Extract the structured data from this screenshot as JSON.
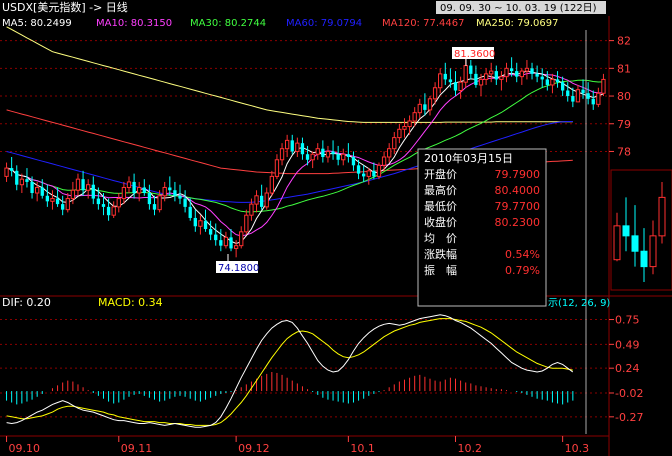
{
  "header": {
    "symbol_title": "USDX[美元指数] -> 日线",
    "date_range": "09. 09. 30 ~ 10. 03. 19 (122日)"
  },
  "ma_legend": [
    {
      "label": "MA5: 80.2499",
      "color": "#ffffff"
    },
    {
      "label": "MA10: 80.3150",
      "color": "#ff40ff"
    },
    {
      "label": "MA30: 80.2744",
      "color": "#40ff40"
    },
    {
      "label": "MA60: 79.0794",
      "color": "#2020ff"
    },
    {
      "label": "MA120: 77.4467",
      "color": "#ff4040"
    },
    {
      "label": "MA250: 79.0697",
      "color": "#ffff80"
    }
  ],
  "annotations": {
    "high_marker": "81.3600",
    "low_marker": "74.1800"
  },
  "info_box": {
    "date": "2010年03月15日",
    "rows": [
      {
        "label": "开盘价",
        "value": "79.7900"
      },
      {
        "label": "最高价",
        "value": "80.4000"
      },
      {
        "label": "最低价",
        "value": "79.7700"
      },
      {
        "label": "收盘价",
        "value": "80.2300"
      },
      {
        "label": "均　价",
        "value": ""
      },
      {
        "label": "涨跌幅",
        "value": "0.54%"
      },
      {
        "label": "振　幅",
        "value": "0.79%"
      }
    ]
  },
  "macd_panel": {
    "dif_label": "DIF: 0.20",
    "macd_label": "MACD: 0.34",
    "params_label": "示(12, 26, 9)"
  },
  "price_axis_labels": [
    "82",
    "81",
    "80",
    "79",
    "78"
  ],
  "macd_axis_labels": [
    "0.75",
    "0.49",
    "0.24",
    "-0.02",
    "-0.27"
  ],
  "date_axis_labels": [
    "09.10",
    "09.11",
    "09.12",
    "10.1",
    "10.2",
    "10.3"
  ],
  "colors": {
    "background": "#000000",
    "axis_text": "#ff4040",
    "grid": "#8b0000",
    "up_candle": "#ff3030",
    "down_candle": "#00ffff",
    "dif_line": "#ffffff",
    "dea_line": "#ffff00",
    "marker_bg": "#ffffff"
  },
  "chart_data": {
    "type": "candlestick",
    "price_ylim": [
      73,
      82.6
    ],
    "macd_ylim": [
      -0.45,
      0.85
    ],
    "candles": [
      [
        77.1,
        77.6,
        76.9,
        77.4
      ],
      [
        77.4,
        77.8,
        77.1,
        77.3
      ],
      [
        77.3,
        77.5,
        76.6,
        76.8
      ],
      [
        76.8,
        77.2,
        76.5,
        77.0
      ],
      [
        77.0,
        77.4,
        76.7,
        76.9
      ],
      [
        76.9,
        77.1,
        76.3,
        76.5
      ],
      [
        76.5,
        76.9,
        76.2,
        76.7
      ],
      [
        76.7,
        77.0,
        76.3,
        76.4
      ],
      [
        76.4,
        76.8,
        76.0,
        76.2
      ],
      [
        76.2,
        76.6,
        75.9,
        76.3
      ],
      [
        76.3,
        76.7,
        76.0,
        76.1
      ],
      [
        76.1,
        76.4,
        75.7,
        75.9
      ],
      [
        75.9,
        76.5,
        75.8,
        76.3
      ],
      [
        76.3,
        76.9,
        76.1,
        76.6
      ],
      [
        76.6,
        77.2,
        76.4,
        77.0
      ],
      [
        77.0,
        77.3,
        76.4,
        76.6
      ],
      [
        76.6,
        77.0,
        76.3,
        76.8
      ],
      [
        76.8,
        77.1,
        76.1,
        76.3
      ],
      [
        76.3,
        76.7,
        75.9,
        76.1
      ],
      [
        76.1,
        76.5,
        75.7,
        76.0
      ],
      [
        76.0,
        76.3,
        75.5,
        75.7
      ],
      [
        75.7,
        76.2,
        75.6,
        76.0
      ],
      [
        76.0,
        76.5,
        75.8,
        76.3
      ],
      [
        76.3,
        76.9,
        76.1,
        76.7
      ],
      [
        76.7,
        77.1,
        76.5,
        76.9
      ],
      [
        76.9,
        77.2,
        76.3,
        76.5
      ],
      [
        76.5,
        76.9,
        76.2,
        76.7
      ],
      [
        76.7,
        77.0,
        76.4,
        76.5
      ],
      [
        76.5,
        76.8,
        75.9,
        76.1
      ],
      [
        76.1,
        76.4,
        75.7,
        75.9
      ],
      [
        75.9,
        76.6,
        75.8,
        76.4
      ],
      [
        76.4,
        76.9,
        76.2,
        76.7
      ],
      [
        76.7,
        77.1,
        76.4,
        76.6
      ],
      [
        76.6,
        76.9,
        76.2,
        76.4
      ],
      [
        76.4,
        76.8,
        76.1,
        76.3
      ],
      [
        76.3,
        76.6,
        75.8,
        76.0
      ],
      [
        76.0,
        76.3,
        75.5,
        75.6
      ],
      [
        75.6,
        75.9,
        75.1,
        75.3
      ],
      [
        75.3,
        75.7,
        75.0,
        75.5
      ],
      [
        75.5,
        75.9,
        75.1,
        75.2
      ],
      [
        75.2,
        75.5,
        74.8,
        75.0
      ],
      [
        75.0,
        75.4,
        74.6,
        74.8
      ],
      [
        74.8,
        75.2,
        74.4,
        74.6
      ],
      [
        74.6,
        75.1,
        74.5,
        74.9
      ],
      [
        74.9,
        75.2,
        74.4,
        74.5
      ],
      [
        74.5,
        74.8,
        74.18,
        74.6
      ],
      [
        74.6,
        75.3,
        74.5,
        75.1
      ],
      [
        75.1,
        75.9,
        75.0,
        75.7
      ],
      [
        75.7,
        76.3,
        75.5,
        76.1
      ],
      [
        76.1,
        76.6,
        75.8,
        76.4
      ],
      [
        76.4,
        76.8,
        75.9,
        76.0
      ],
      [
        76.0,
        76.7,
        75.9,
        76.5
      ],
      [
        76.5,
        77.3,
        76.4,
        77.1
      ],
      [
        77.1,
        77.9,
        77.0,
        77.7
      ],
      [
        77.7,
        78.3,
        77.5,
        78.1
      ],
      [
        78.1,
        78.6,
        77.8,
        78.4
      ],
      [
        78.4,
        78.6,
        77.9,
        78.0
      ],
      [
        78.0,
        78.5,
        77.8,
        78.3
      ],
      [
        78.3,
        78.5,
        77.7,
        77.9
      ],
      [
        77.9,
        78.2,
        77.5,
        77.7
      ],
      [
        77.7,
        78.0,
        77.4,
        77.9
      ],
      [
        77.9,
        78.3,
        77.7,
        78.1
      ],
      [
        78.1,
        78.4,
        77.6,
        77.8
      ],
      [
        77.8,
        78.2,
        77.6,
        78.0
      ],
      [
        78.0,
        78.4,
        77.7,
        77.9
      ],
      [
        77.9,
        78.2,
        77.5,
        77.7
      ],
      [
        77.7,
        78.1,
        77.5,
        77.9
      ],
      [
        77.9,
        78.3,
        77.6,
        77.8
      ],
      [
        77.8,
        78.0,
        77.3,
        77.5
      ],
      [
        77.5,
        77.7,
        77.0,
        77.2
      ],
      [
        77.2,
        77.5,
        76.9,
        77.1
      ],
      [
        77.1,
        77.4,
        76.8,
        77.3
      ],
      [
        77.3,
        77.6,
        77.0,
        77.1
      ],
      [
        77.1,
        77.6,
        77.0,
        77.5
      ],
      [
        77.5,
        78.0,
        77.3,
        77.8
      ],
      [
        77.8,
        78.3,
        77.6,
        78.1
      ],
      [
        78.1,
        78.7,
        77.9,
        78.5
      ],
      [
        78.5,
        79.0,
        78.3,
        78.8
      ],
      [
        78.8,
        79.2,
        78.5,
        78.9
      ],
      [
        78.9,
        79.3,
        78.6,
        79.1
      ],
      [
        79.1,
        79.6,
        78.9,
        79.4
      ],
      [
        79.4,
        79.9,
        79.2,
        79.7
      ],
      [
        79.7,
        80.1,
        79.3,
        79.5
      ],
      [
        79.5,
        80.0,
        79.3,
        79.9
      ],
      [
        79.9,
        80.5,
        79.7,
        80.3
      ],
      [
        80.3,
        81.0,
        80.1,
        80.8
      ],
      [
        80.8,
        81.2,
        80.4,
        80.6
      ],
      [
        80.6,
        81.0,
        80.3,
        80.5
      ],
      [
        80.5,
        80.9,
        80.0,
        80.2
      ],
      [
        80.2,
        80.7,
        79.9,
        80.5
      ],
      [
        80.5,
        81.36,
        80.3,
        81.1
      ],
      [
        81.1,
        81.3,
        80.6,
        80.8
      ],
      [
        80.8,
        81.1,
        80.3,
        80.4
      ],
      [
        80.4,
        80.8,
        80.0,
        80.6
      ],
      [
        80.6,
        81.0,
        80.4,
        80.8
      ],
      [
        80.8,
        81.2,
        80.5,
        80.9
      ],
      [
        80.9,
        81.1,
        80.4,
        80.6
      ],
      [
        80.6,
        80.9,
        80.2,
        80.7
      ],
      [
        80.7,
        81.2,
        80.5,
        81.0
      ],
      [
        81.0,
        81.4,
        80.7,
        80.9
      ],
      [
        80.9,
        81.2,
        80.5,
        80.7
      ],
      [
        80.7,
        81.0,
        80.4,
        80.9
      ],
      [
        80.9,
        81.3,
        80.6,
        81.0
      ],
      [
        81.0,
        81.2,
        80.6,
        80.8
      ],
      [
        80.8,
        81.1,
        80.5,
        80.7
      ],
      [
        80.7,
        81.0,
        80.3,
        80.6
      ],
      [
        80.6,
        80.9,
        80.2,
        80.4
      ],
      [
        80.4,
        80.8,
        80.1,
        80.6
      ],
      [
        80.6,
        80.9,
        80.3,
        80.5
      ],
      [
        80.5,
        80.7,
        80.0,
        80.2
      ],
      [
        80.2,
        80.5,
        79.8,
        80.0
      ],
      [
        80.0,
        80.3,
        79.6,
        79.8
      ],
      [
        79.79,
        80.4,
        79.77,
        80.23
      ],
      [
        80.23,
        80.6,
        79.9,
        80.1
      ],
      [
        80.1,
        80.5,
        79.7,
        79.9
      ],
      [
        79.9,
        80.2,
        79.5,
        79.7
      ],
      [
        79.7,
        80.3,
        79.6,
        80.1
      ],
      [
        80.1,
        80.8,
        80.0,
        80.6
      ]
    ],
    "macd_hist": [
      -0.1,
      -0.12,
      -0.14,
      -0.13,
      -0.11,
      -0.09,
      -0.06,
      -0.03,
      0.0,
      0.03,
      0.06,
      0.09,
      0.11,
      0.1,
      0.07,
      0.04,
      0.01,
      -0.02,
      -0.05,
      -0.08,
      -0.11,
      -0.13,
      -0.12,
      -0.09,
      -0.06,
      -0.04,
      -0.03,
      -0.05,
      -0.07,
      -0.09,
      -0.11,
      -0.1,
      -0.08,
      -0.06,
      -0.05,
      -0.06,
      -0.08,
      -0.1,
      -0.11,
      -0.09,
      -0.07,
      -0.05,
      -0.03,
      -0.02,
      -0.01,
      0.01,
      0.04,
      0.07,
      0.1,
      0.13,
      0.16,
      0.18,
      0.2,
      0.19,
      0.17,
      0.14,
      0.11,
      0.08,
      0.05,
      0.02,
      -0.01,
      -0.04,
      -0.07,
      -0.09,
      -0.1,
      -0.11,
      -0.12,
      -0.13,
      -0.12,
      -0.1,
      -0.08,
      -0.05,
      -0.03,
      -0.01,
      0.01,
      0.04,
      0.07,
      0.1,
      0.12,
      0.14,
      0.16,
      0.17,
      0.15,
      0.13,
      0.11,
      0.1,
      0.12,
      0.14,
      0.13,
      0.11,
      0.09,
      0.08,
      0.06,
      0.05,
      0.04,
      0.03,
      0.02,
      0.02,
      0.01,
      0.0,
      -0.01,
      -0.02,
      -0.04,
      -0.06,
      -0.08,
      -0.09,
      -0.1,
      -0.12,
      -0.13,
      -0.14,
      -0.12,
      -0.1
    ],
    "dif": [
      -0.33,
      -0.34,
      -0.33,
      -0.31,
      -0.28,
      -0.25,
      -0.22,
      -0.2,
      -0.17,
      -0.14,
      -0.12,
      -0.1,
      -0.12,
      -0.15,
      -0.18,
      -0.2,
      -0.21,
      -0.22,
      -0.24,
      -0.26,
      -0.28,
      -0.3,
      -0.31,
      -0.31,
      -0.32,
      -0.33,
      -0.34,
      -0.34,
      -0.33,
      -0.34,
      -0.35,
      -0.36,
      -0.35,
      -0.34,
      -0.35,
      -0.36,
      -0.37,
      -0.38,
      -0.38,
      -0.37,
      -0.36,
      -0.33,
      -0.27,
      -0.18,
      -0.08,
      0.03,
      0.14,
      0.24,
      0.34,
      0.44,
      0.53,
      0.6,
      0.66,
      0.7,
      0.73,
      0.74,
      0.72,
      0.66,
      0.58,
      0.5,
      0.41,
      0.32,
      0.26,
      0.22,
      0.2,
      0.21,
      0.26,
      0.33,
      0.42,
      0.5,
      0.56,
      0.61,
      0.65,
      0.68,
      0.7,
      0.71,
      0.7,
      0.69,
      0.7,
      0.72,
      0.74,
      0.76,
      0.77,
      0.78,
      0.79,
      0.8,
      0.79,
      0.77,
      0.74,
      0.72,
      0.69,
      0.66,
      0.62,
      0.58,
      0.54,
      0.5,
      0.45,
      0.4,
      0.35,
      0.3,
      0.27,
      0.24,
      0.22,
      0.21,
      0.2,
      0.21,
      0.24,
      0.28,
      0.3,
      0.28,
      0.24,
      0.2
    ],
    "dea": [
      -0.26,
      -0.27,
      -0.28,
      -0.29,
      -0.29,
      -0.28,
      -0.27,
      -0.26,
      -0.24,
      -0.22,
      -0.19,
      -0.17,
      -0.16,
      -0.16,
      -0.17,
      -0.18,
      -0.19,
      -0.2,
      -0.21,
      -0.22,
      -0.24,
      -0.25,
      -0.27,
      -0.28,
      -0.29,
      -0.3,
      -0.31,
      -0.32,
      -0.32,
      -0.32,
      -0.33,
      -0.33,
      -0.34,
      -0.34,
      -0.34,
      -0.35,
      -0.35,
      -0.36,
      -0.36,
      -0.36,
      -0.36,
      -0.35,
      -0.33,
      -0.29,
      -0.24,
      -0.18,
      -0.12,
      -0.05,
      0.03,
      0.11,
      0.19,
      0.27,
      0.35,
      0.42,
      0.49,
      0.55,
      0.59,
      0.62,
      0.63,
      0.62,
      0.6,
      0.56,
      0.52,
      0.48,
      0.43,
      0.39,
      0.36,
      0.35,
      0.36,
      0.38,
      0.41,
      0.45,
      0.49,
      0.53,
      0.57,
      0.6,
      0.63,
      0.65,
      0.67,
      0.69,
      0.7,
      0.72,
      0.73,
      0.74,
      0.75,
      0.76,
      0.76,
      0.76,
      0.75,
      0.74,
      0.73,
      0.71,
      0.69,
      0.67,
      0.64,
      0.61,
      0.57,
      0.53,
      0.49,
      0.45,
      0.41,
      0.38,
      0.35,
      0.32,
      0.29,
      0.27,
      0.25,
      0.24,
      0.24,
      0.24,
      0.23,
      0.22
    ],
    "ma250": [
      82.5,
      82.4,
      82.3,
      82.2,
      82.1,
      82.0,
      81.9,
      81.8,
      81.7,
      81.6,
      81.55,
      81.5,
      81.45,
      81.4,
      81.35,
      81.3,
      81.25,
      81.2,
      81.15,
      81.1,
      81.05,
      81.0,
      80.95,
      80.9,
      80.85,
      80.8,
      80.75,
      80.7,
      80.65,
      80.6,
      80.55,
      80.5,
      80.45,
      80.4,
      80.35,
      80.3,
      80.25,
      80.2,
      80.15,
      80.1,
      80.05,
      80.0,
      79.95,
      79.9,
      79.85,
      79.8,
      79.75,
      79.7,
      79.65,
      79.6,
      79.55,
      79.5,
      79.47,
      79.44,
      79.41,
      79.38,
      79.35,
      79.32,
      79.29,
      79.26,
      79.23,
      79.2,
      79.18,
      79.16,
      79.14,
      79.12,
      79.1,
      79.08,
      79.07,
      79.06,
      79.05,
      79.05,
      79.05,
      79.05,
      79.05,
      79.05,
      79.05,
      79.05,
      79.05,
      79.05,
      79.05,
      79.05,
      79.05,
      79.05,
      79.05,
      79.05,
      79.06,
      79.06,
      79.06,
      79.06,
      79.06,
      79.06,
      79.06,
      79.06,
      79.06,
      79.06,
      79.07,
      79.07,
      79.07,
      79.07,
      79.07,
      79.07,
      79.07,
      79.07,
      79.07,
      79.07,
      79.07,
      79.07,
      79.07,
      79.07,
      79.07,
      79.07
    ],
    "ma120": [
      79.5,
      79.45,
      79.4,
      79.35,
      79.3,
      79.25,
      79.2,
      79.15,
      79.1,
      79.05,
      79.0,
      78.95,
      78.9,
      78.85,
      78.8,
      78.75,
      78.7,
      78.65,
      78.6,
      78.55,
      78.5,
      78.45,
      78.4,
      78.35,
      78.3,
      78.25,
      78.2,
      78.15,
      78.1,
      78.05,
      78.0,
      77.95,
      77.9,
      77.85,
      77.8,
      77.75,
      77.7,
      77.65,
      77.6,
      77.55,
      77.5,
      77.45,
      77.4,
      77.38,
      77.36,
      77.34,
      77.32,
      77.3,
      77.28,
      77.26,
      77.25,
      77.24,
      77.23,
      77.22,
      77.21,
      77.2,
      77.2,
      77.2,
      77.2,
      77.2,
      77.2,
      77.2,
      77.2,
      77.2,
      77.21,
      77.22,
      77.23,
      77.24,
      77.25,
      77.26,
      77.27,
      77.28,
      77.29,
      77.3,
      77.31,
      77.32,
      77.33,
      77.34,
      77.35,
      77.36,
      77.37,
      77.38,
      77.39,
      77.4,
      77.41,
      77.42,
      77.43,
      77.44,
      77.45,
      77.46,
      77.47,
      77.48,
      77.49,
      77.5,
      77.51,
      77.52,
      77.53,
      77.54,
      77.55,
      77.56,
      77.57,
      77.58,
      77.59,
      77.6,
      77.61,
      77.62,
      77.63,
      77.64,
      77.65,
      77.66,
      77.67,
      77.68
    ],
    "ma60": [
      78.0,
      77.95,
      77.9,
      77.85,
      77.8,
      77.75,
      77.7,
      77.65,
      77.6,
      77.55,
      77.5,
      77.45,
      77.4,
      77.35,
      77.3,
      77.25,
      77.2,
      77.15,
      77.1,
      77.05,
      77.0,
      76.95,
      76.9,
      76.85,
      76.8,
      76.75,
      76.7,
      76.65,
      76.6,
      76.55,
      76.5,
      76.47,
      76.44,
      76.41,
      76.38,
      76.35,
      76.32,
      76.3,
      76.28,
      76.26,
      76.24,
      76.22,
      76.2,
      76.19,
      76.18,
      76.17,
      76.16,
      76.16,
      76.17,
      76.18,
      76.2,
      76.22,
      76.25,
      76.28,
      76.31,
      76.34,
      76.37,
      76.4,
      76.43,
      76.46,
      76.5,
      76.54,
      76.58,
      76.62,
      76.66,
      76.7,
      76.74,
      76.78,
      76.82,
      76.86,
      76.9,
      76.95,
      77.0,
      77.05,
      77.1,
      77.15,
      77.2,
      77.26,
      77.32,
      77.38,
      77.44,
      77.5,
      77.56,
      77.62,
      77.68,
      77.74,
      77.8,
      77.86,
      77.92,
      77.98,
      78.04,
      78.1,
      78.16,
      78.22,
      78.28,
      78.34,
      78.4,
      78.46,
      78.52,
      78.58,
      78.64,
      78.7,
      78.76,
      78.82,
      78.88,
      78.93,
      78.98,
      79.02,
      79.05,
      79.07,
      79.08,
      79.08
    ]
  }
}
